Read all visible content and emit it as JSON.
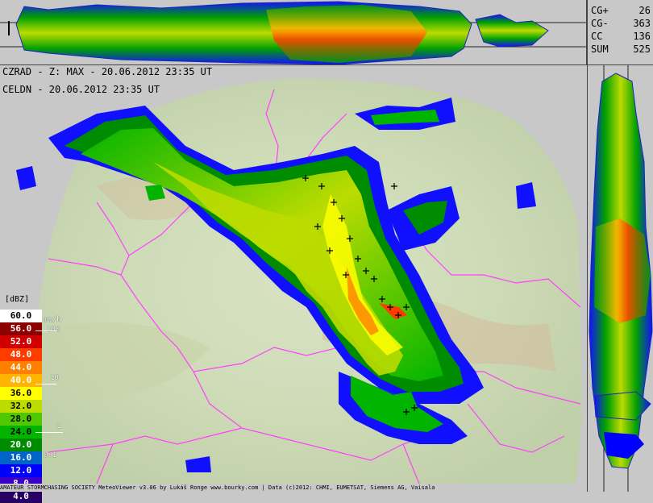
{
  "stats": [
    {
      "key": "CG+",
      "value": "26"
    },
    {
      "key": "CG-",
      "value": "363"
    },
    {
      "key": "CC",
      "value": "136"
    },
    {
      "key": "SUM",
      "value": "525"
    }
  ],
  "header": {
    "line1": "CZRAD - Z: MAX - 20.06.2012 23:35 UT",
    "line2": "CELDN - 20.06.2012 23:35 UT"
  },
  "legend": {
    "unit": "[dBZ]",
    "rate_unit": "mm/h",
    "levels": [
      {
        "label": "60.0",
        "color": "#ffffff",
        "text_color": "#000000"
      },
      {
        "label": "56.0",
        "color": "#8c0000",
        "text_color": "#ffffff"
      },
      {
        "label": "52.0",
        "color": "#d00000",
        "text_color": "#ffffff"
      },
      {
        "label": "48.0",
        "color": "#ff3c00",
        "text_color": "#ffffff"
      },
      {
        "label": "44.0",
        "color": "#ff8000",
        "text_color": "#ffffff"
      },
      {
        "label": "40.0",
        "color": "#ffb400",
        "text_color": "#ffffff"
      },
      {
        "label": "36.0",
        "color": "#ffff00",
        "text_color": "#000000"
      },
      {
        "label": "32.0",
        "color": "#bcdc00",
        "text_color": "#000000"
      },
      {
        "label": "28.0",
        "color": "#50c800",
        "text_color": "#000000"
      },
      {
        "label": "24.0",
        "color": "#00b400",
        "text_color": "#000000"
      },
      {
        "label": "20.0",
        "color": "#008c00",
        "text_color": "#ffffff"
      },
      {
        "label": "16.0",
        "color": "#0064c8",
        "text_color": "#ffffff"
      },
      {
        "label": "12.0",
        "color": "#0000ff",
        "text_color": "#ffffff"
      },
      {
        "label": "8.0",
        "color": "#3c00c8",
        "text_color": "#ffffff"
      },
      {
        "label": "4.0",
        "color": "#280064",
        "text_color": "#ffffff"
      }
    ],
    "rates": [
      "100",
      "10",
      "1",
      "0.1"
    ]
  },
  "footer": "AMATEUR STORMCHASING SOCIETY MeteoViewer v3.06 by Lukáš Ronge www.bourky.com | Data (c)2012: CHMI, EUMETSAT, Siemens AG, Vaisala",
  "colors": {
    "background": "#c8c8c8",
    "terrain_low": "#cfe0c0",
    "terrain_high": "#d9bfa0",
    "border_line": "#ff40ff"
  }
}
